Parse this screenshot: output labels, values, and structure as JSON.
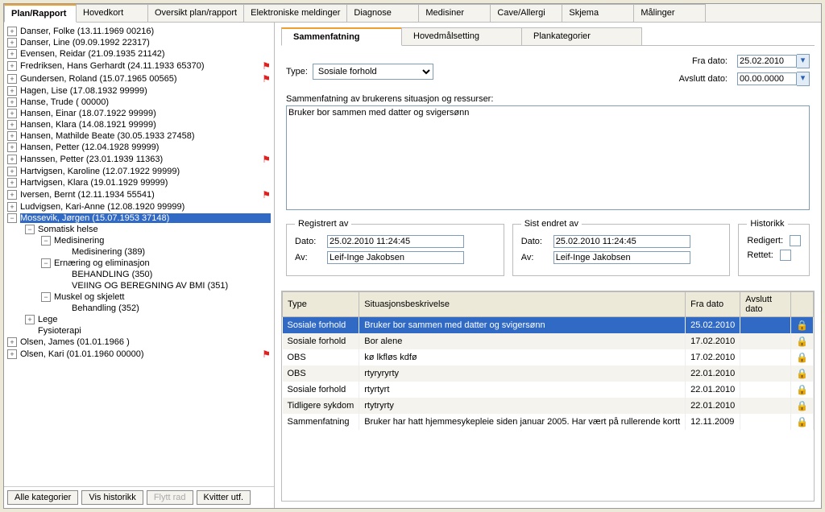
{
  "main_tabs": [
    "Plan/Rapport",
    "Hovedkort",
    "Oversikt plan/rapport",
    "Elektroniske meldinger",
    "Diagnose",
    "Medisiner",
    "Cave/Allergi",
    "Skjema",
    "Målinger"
  ],
  "main_tab_active": 0,
  "tree": [
    {
      "lvl": 0,
      "exp": "+",
      "label": "Danser, Folke (13.11.1969 00216)",
      "flag": false,
      "sel": false
    },
    {
      "lvl": 0,
      "exp": "+",
      "label": "Danser, Line (09.09.1992 22317)",
      "flag": false,
      "sel": false
    },
    {
      "lvl": 0,
      "exp": "+",
      "label": "Evensen, Reidar (21.09.1935 21142)",
      "flag": false,
      "sel": false
    },
    {
      "lvl": 0,
      "exp": "+",
      "label": "Fredriksen, Hans Gerhardt (24.11.1933 65370)",
      "flag": true,
      "sel": false
    },
    {
      "lvl": 0,
      "exp": "+",
      "label": "Gundersen, Roland (15.07.1965 00565)",
      "flag": true,
      "sel": false
    },
    {
      "lvl": 0,
      "exp": "+",
      "label": "Hagen, Lise (17.08.1932 99999)",
      "flag": false,
      "sel": false
    },
    {
      "lvl": 0,
      "exp": "+",
      "label": "Hanse, Trude ( 00000)",
      "flag": false,
      "sel": false
    },
    {
      "lvl": 0,
      "exp": "+",
      "label": "Hansen, Einar (18.07.1922 99999)",
      "flag": false,
      "sel": false
    },
    {
      "lvl": 0,
      "exp": "+",
      "label": "Hansen, Klara (14.08.1921 99999)",
      "flag": false,
      "sel": false
    },
    {
      "lvl": 0,
      "exp": "+",
      "label": "Hansen, Mathilde Beate (30.05.1933 27458)",
      "flag": false,
      "sel": false
    },
    {
      "lvl": 0,
      "exp": "+",
      "label": "Hansen, Petter (12.04.1928 99999)",
      "flag": false,
      "sel": false
    },
    {
      "lvl": 0,
      "exp": "+",
      "label": "Hanssen, Petter (23.01.1939 11363)",
      "flag": true,
      "sel": false
    },
    {
      "lvl": 0,
      "exp": "+",
      "label": "Hartvigsen, Karoline (12.07.1922 99999)",
      "flag": false,
      "sel": false
    },
    {
      "lvl": 0,
      "exp": "+",
      "label": "Hartvigsen, Klara (19.01.1929 99999)",
      "flag": false,
      "sel": false
    },
    {
      "lvl": 0,
      "exp": "+",
      "label": "Iversen, Bernt (12.11.1934 55541)",
      "flag": true,
      "sel": false
    },
    {
      "lvl": 0,
      "exp": "+",
      "label": "Ludvigsen, Kari-Anne (12.08.1920 99999)",
      "flag": false,
      "sel": false
    },
    {
      "lvl": 0,
      "exp": "−",
      "label": "Mossevik, Jørgen (15.07.1953 37148)",
      "flag": false,
      "sel": true
    },
    {
      "lvl": 1,
      "exp": "−",
      "label": "Somatisk helse",
      "flag": false,
      "sel": false
    },
    {
      "lvl": 2,
      "exp": "−",
      "label": "Medisinering",
      "flag": false,
      "sel": false
    },
    {
      "lvl": 3,
      "exp": "",
      "label": "Medisinering (389)",
      "flag": false,
      "sel": false
    },
    {
      "lvl": 2,
      "exp": "−",
      "label": "Ernæring og eliminasjon",
      "flag": false,
      "sel": false
    },
    {
      "lvl": 3,
      "exp": "",
      "label": "BEHANDLING (350)",
      "flag": false,
      "sel": false
    },
    {
      "lvl": 3,
      "exp": "",
      "label": "VEIING OG BEREGNING AV BMI (351)",
      "flag": false,
      "sel": false
    },
    {
      "lvl": 2,
      "exp": "−",
      "label": "Muskel og skjelett",
      "flag": false,
      "sel": false
    },
    {
      "lvl": 3,
      "exp": "",
      "label": "Behandling (352)",
      "flag": false,
      "sel": false
    },
    {
      "lvl": 1,
      "exp": "+",
      "label": "Lege",
      "flag": false,
      "sel": false
    },
    {
      "lvl": 1,
      "exp": "",
      "label": "Fysioterapi",
      "flag": false,
      "sel": false
    },
    {
      "lvl": 0,
      "exp": "+",
      "label": "Olsen, James (01.01.1966 )",
      "flag": false,
      "sel": false
    },
    {
      "lvl": 0,
      "exp": "+",
      "label": "Olsen, Kari (01.01.1960 00000)",
      "flag": true,
      "sel": false
    }
  ],
  "left_buttons": {
    "alle": "Alle kategorier",
    "vis": "Vis historikk",
    "flytt": "Flytt rad",
    "kvitter": "Kvitter utf."
  },
  "sub_tabs": [
    "Sammenfatning",
    "Hovedmålsetting",
    "Plankategorier"
  ],
  "sub_tab_active": 0,
  "form": {
    "type_label": "Type:",
    "type_value": "Sosiale forhold",
    "fra_label": "Fra dato:",
    "fra_value": "25.02.2010",
    "avslutt_label": "Avslutt dato:",
    "avslutt_value": "00.00.0000",
    "summary_label": "Sammenfatning av brukerens situasjon og ressurser:",
    "summary_text": "Bruker bor sammen med datter og svigersønn"
  },
  "registrert": {
    "legend": "Registrert av",
    "dato_label": "Dato:",
    "dato": "25.02.2010 11:24:45",
    "av_label": "Av:",
    "av": "Leif-Inge Jakobsen"
  },
  "sist": {
    "legend": "Sist endret av",
    "dato_label": "Dato:",
    "dato": "25.02.2010 11:24:45",
    "av_label": "Av:",
    "av": "Leif-Inge Jakobsen"
  },
  "historikk": {
    "legend": "Historikk",
    "redigert": "Redigert:",
    "rettet": "Rettet:"
  },
  "table": {
    "headers": [
      "Type",
      "Situasjonsbeskrivelse",
      "Fra dato",
      "Avslutt dato",
      ""
    ],
    "rows": [
      {
        "sel": true,
        "c": [
          "Sosiale forhold",
          "Bruker bor sammen med datter og svigersønn",
          "25.02.2010",
          "",
          "🔒"
        ]
      },
      {
        "sel": false,
        "c": [
          "Sosiale forhold",
          "Bor alene",
          "17.02.2010",
          "",
          "🔒"
        ]
      },
      {
        "sel": false,
        "c": [
          "OBS",
          " kø lkfløs kdfø",
          "17.02.2010",
          "",
          "🔒"
        ]
      },
      {
        "sel": false,
        "c": [
          "OBS",
          "rtyryryrty",
          "22.01.2010",
          "",
          "🔒"
        ]
      },
      {
        "sel": false,
        "c": [
          "Sosiale forhold",
          "rtyrtyrt",
          "22.01.2010",
          "",
          "🔒"
        ]
      },
      {
        "sel": false,
        "c": [
          "Tidligere sykdom",
          "rtytryrty",
          "22.01.2010",
          "",
          "🔒"
        ]
      },
      {
        "sel": false,
        "c": [
          "Sammenfatning",
          "Bruker har hatt hjemmesykepleie siden januar 2005. Har vært på rullerende kortt",
          "12.11.2009",
          "",
          "🔒"
        ]
      }
    ]
  }
}
